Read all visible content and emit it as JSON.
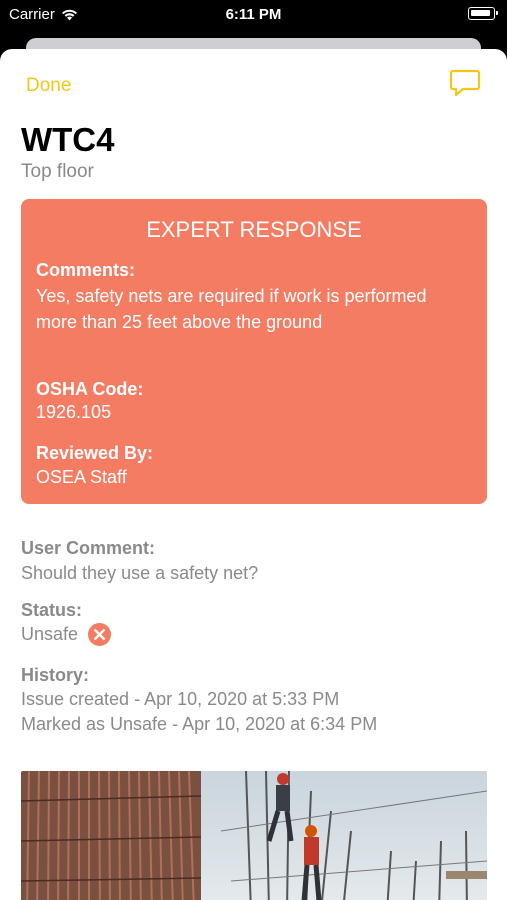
{
  "status_bar": {
    "carrier": "Carrier",
    "time": "6:11 PM"
  },
  "nav": {
    "done_label": "Done",
    "chat_icon": "chat-bubble-icon"
  },
  "header": {
    "title": "WTC4",
    "subtitle": "Top floor"
  },
  "expert_response": {
    "heading": "EXPERT RESPONSE",
    "comments_label": "Comments:",
    "comments_value": "Yes, safety nets are required if work is performed more than 25 feet above the ground",
    "osha_label": "OSHA Code:",
    "osha_value": "1926.105",
    "reviewed_label": "Reviewed By:",
    "reviewed_value": "OSEA Staff",
    "background_color": "#f47c63"
  },
  "details": {
    "user_comment_label": "User Comment:",
    "user_comment_value": "Should they use a safety net?",
    "status_label": "Status:",
    "status_value": "Unsafe",
    "status_icon": "x-circle-icon",
    "history_label": "History:",
    "history_items": [
      "Issue created - Apr 10, 2020 at 5:33 PM",
      "Marked as Unsafe - Apr 10, 2020 at 6:34 PM"
    ]
  },
  "colors": {
    "accent": "#f5c518",
    "status_unsafe": "#f47c63",
    "secondary_text": "#8a8a8e"
  }
}
